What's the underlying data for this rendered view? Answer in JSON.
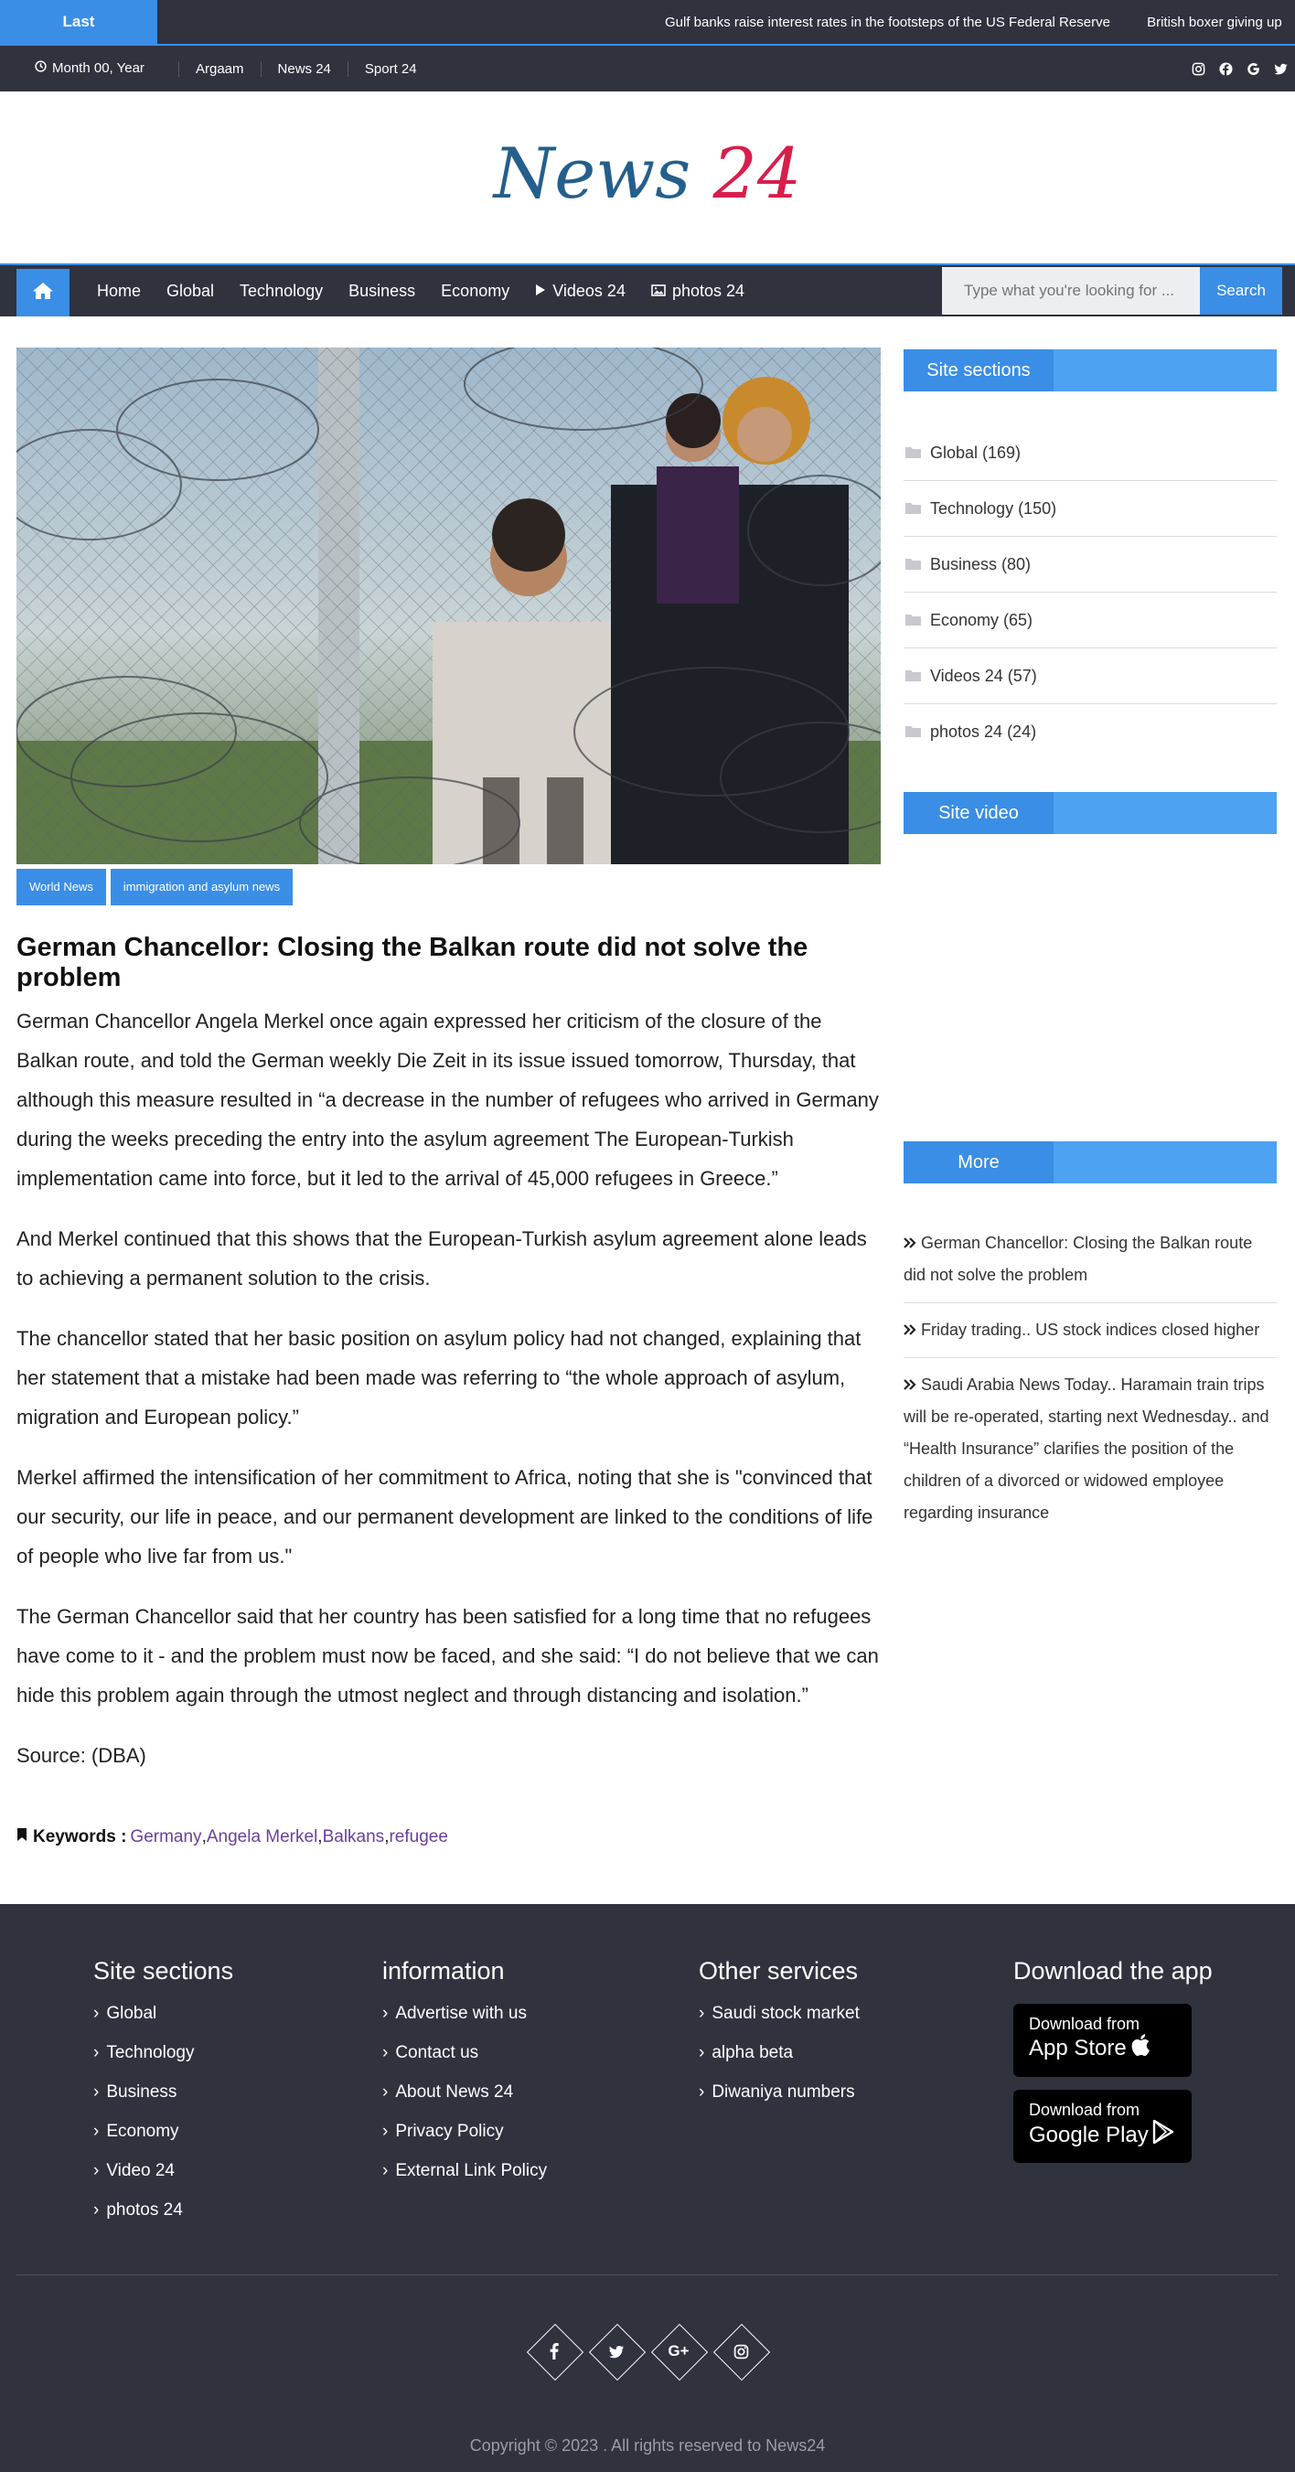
{
  "ticker": {
    "label": "Last",
    "items": [
      "Gulf banks raise interest rates in the footsteps of the US Federal Reserve",
      "British boxer giving up"
    ]
  },
  "topbar": {
    "date": "Month 00, Year",
    "links": [
      "Argaam",
      "News 24",
      "Sport 24"
    ],
    "social_icons": [
      "instagram-icon",
      "facebook-icon",
      "google-icon",
      "twitter-icon"
    ]
  },
  "logo": {
    "part1": "News",
    "part2": "24",
    "colors": {
      "part1": "#245f8c",
      "part2": "#d81e4b"
    }
  },
  "nav": {
    "home_icon": "home-icon",
    "links": [
      "Home",
      "Global",
      "Technology",
      "Business",
      "Economy",
      "Videos 24",
      "photos 24"
    ],
    "search_placeholder": "Type what you're looking for ...",
    "search_label": "Search"
  },
  "article": {
    "tags": [
      "World News",
      "immigration and asylum news"
    ],
    "title": "German Chancellor: Closing the Balkan route did not solve the problem",
    "paragraphs": [
      "German Chancellor Angela Merkel once again expressed her criticism of the closure of the Balkan route, and told the German weekly Die Zeit in its issue issued tomorrow, Thursday, that although this measure resulted in “a decrease in the number of refugees who arrived in Germany during the weeks preceding the entry into the asylum agreement The European-Turkish implementation came into force, but it led to the arrival of 45,000 refugees in Greece.”",
      "And Merkel continued that this shows that the European-Turkish asylum agreement alone leads to achieving a permanent solution to the crisis.",
      "The chancellor stated that her basic position on asylum policy had not changed, explaining that her statement that a mistake had been made was referring to “the whole approach of asylum, migration and European policy.”",
      "Merkel affirmed the intensification of her commitment to Africa, noting that she is \"convinced that our security, our life in peace, and our permanent development are linked to the conditions of life of people who live far from us.\"",
      "The German Chancellor said that her country has been satisfied for a long time that no refugees have come to it - and the problem must now be faced, and she said: “I do not believe that we can hide this problem again through the utmost neglect and through distancing and isolation.”",
      "Source: (DBA)"
    ],
    "keywords_label": "Keywords :",
    "keywords": [
      "Germany",
      "Angela Merkel",
      "Balkans",
      "refugee"
    ]
  },
  "sidebar": {
    "sections_title": "Site sections",
    "categories": [
      "Global (169)",
      "Technology (150)",
      "Business (80)",
      "Economy (65)",
      "Videos 24 (57)",
      "photos 24 (24)"
    ],
    "video_title": "Site video",
    "more_title": "More",
    "more_items": [
      "German Chancellor: Closing the Balkan route did not solve the problem",
      "Friday trading.. US stock indices closed higher",
      "Saudi Arabia News Today.. Haramain train trips will be re-operated, starting next Wednesday.. and “Health Insurance” clarifies the position of the children of a divorced or widowed employee regarding insurance"
    ]
  },
  "footer": {
    "col1": {
      "title": "Site sections",
      "items": [
        "Global",
        "Technology",
        "Business",
        "Economy",
        "Video 24",
        "photos 24"
      ]
    },
    "col2": {
      "title": "information",
      "items": [
        "Advertise with us",
        "Contact us",
        "About News 24",
        "Privacy Policy",
        "External Link Policy"
      ]
    },
    "col3": {
      "title": "Other services",
      "items": [
        "Saudi stock market",
        "alpha beta",
        "Diwaniya numbers"
      ]
    },
    "col4": {
      "title": "Download the app",
      "appstore": {
        "small": "Download from",
        "big": "App Store"
      },
      "googleplay": {
        "small": "Download from",
        "big": "Google Play"
      }
    },
    "social_icons": [
      "facebook-icon",
      "twitter-icon",
      "google-plus-icon",
      "instagram-icon"
    ],
    "google_plus_glyph": "G+",
    "copyright": "Copyright © 2023 . All rights reserved to News24"
  },
  "colors": {
    "accent": "#3a8ee6",
    "dark": "#30323e"
  }
}
